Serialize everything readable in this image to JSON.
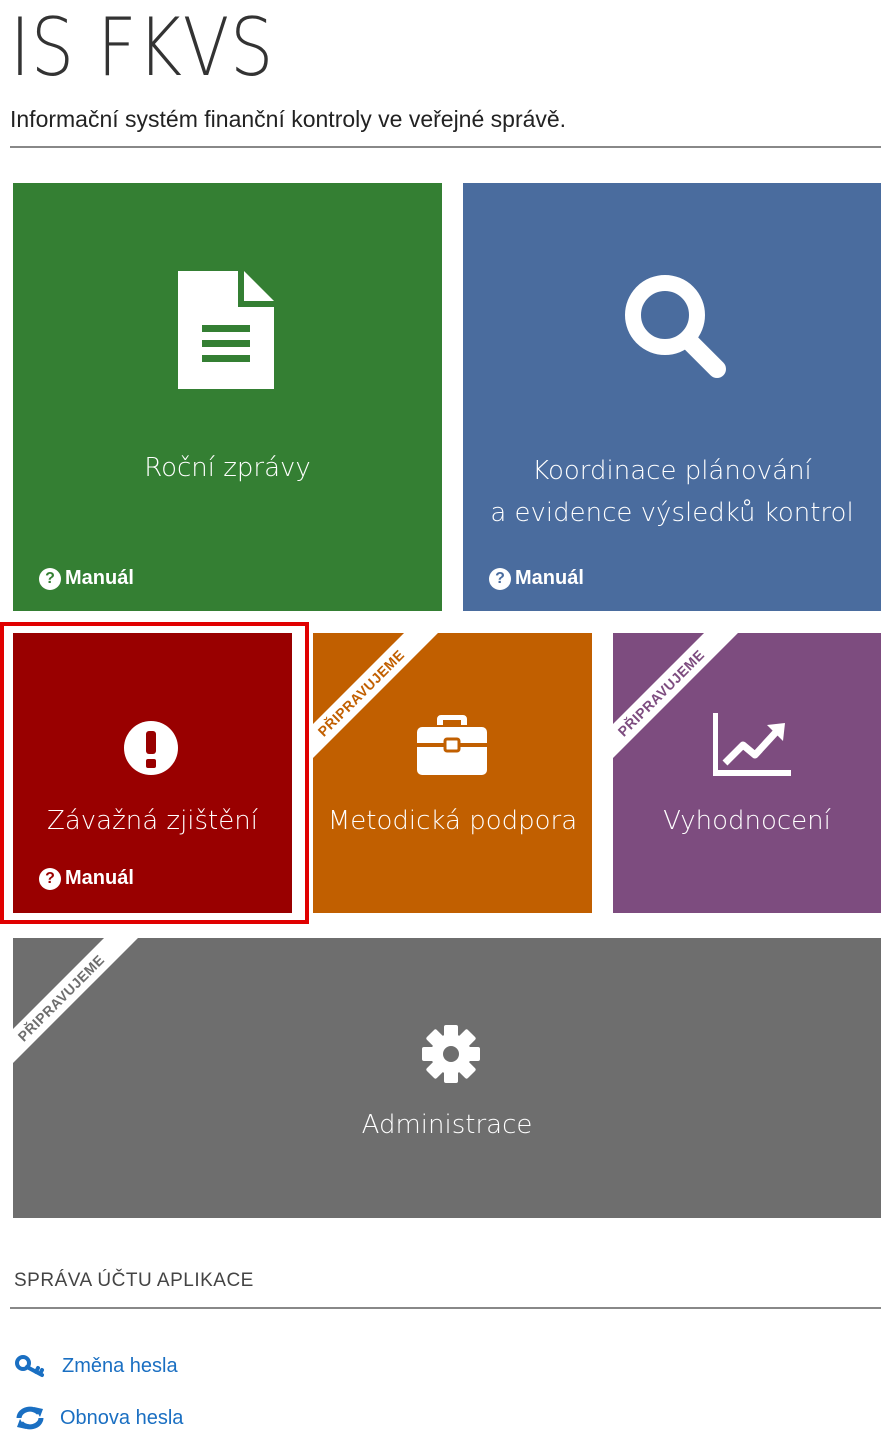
{
  "header": {
    "title": "IS FKVS",
    "subtitle": "Informační systém finanční kontroly ve veřejné správě."
  },
  "colors": {
    "green": "#347f33",
    "blue": "#4a6c9e",
    "red": "#990000",
    "orange": "#c15f00",
    "purple": "#7d4c7f",
    "gray": "#6e6e6e",
    "link": "#1a6fc2",
    "highlight": "#e00000"
  },
  "tiles": {
    "rocni": {
      "label": "Roční zprávy",
      "manual": "Manuál",
      "icon": "document-icon"
    },
    "koordinace": {
      "label_line1": "Koordinace plánování",
      "label_line2": "a evidence výsledků kontrol",
      "manual": "Manuál",
      "icon": "search-icon"
    },
    "zavazna": {
      "label": "Závažná zjištění",
      "manual": "Manuál",
      "icon": "exclamation-icon",
      "highlighted": true
    },
    "metodicka": {
      "label": "Metodická podpora",
      "ribbon": "PŘIPRAVUJEME",
      "icon": "briefcase-icon"
    },
    "vyhodnoceni": {
      "label": "Vyhodnocení",
      "ribbon": "PŘIPRAVUJEME",
      "icon": "line-chart-icon"
    },
    "administrace": {
      "label": "Administrace",
      "ribbon": "PŘIPRAVUJEME",
      "icon": "gear-icon"
    }
  },
  "account": {
    "heading": "Správa účtu aplikace",
    "links": [
      {
        "label": "Změna hesla",
        "icon": "key-icon"
      },
      {
        "label": "Obnova hesla",
        "icon": "refresh-icon"
      }
    ]
  }
}
